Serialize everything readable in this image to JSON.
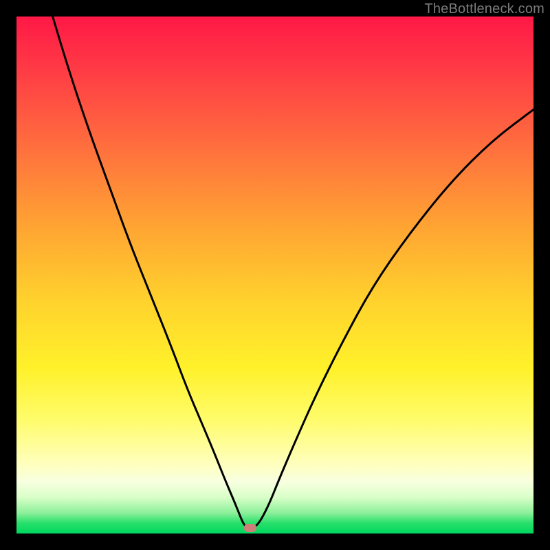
{
  "watermark": "TheBottleneck.com",
  "chart_data": {
    "type": "line",
    "title": "",
    "xlabel": "",
    "ylabel": "",
    "xlim": [
      0,
      100
    ],
    "ylim": [
      0,
      100
    ],
    "grid": false,
    "legend": false,
    "series": [
      {
        "name": "curve",
        "x": [
          7,
          10,
          14,
          18,
          22,
          26,
          30,
          33,
          36,
          38.5,
          40.5,
          42,
          43,
          43.7,
          44.3,
          45.3,
          46,
          46.6,
          47.5,
          49,
          51,
          54,
          58,
          63,
          69,
          76,
          84,
          92,
          100
        ],
        "y": [
          100,
          90,
          78,
          67,
          56,
          46,
          36,
          28,
          21,
          15,
          10,
          6.5,
          4,
          2.3,
          1.3,
          1.2,
          1.3,
          1.7,
          3,
          6,
          11,
          18,
          27,
          37,
          48,
          58,
          68,
          76,
          82
        ]
      }
    ],
    "marker": {
      "x": 45.2,
      "y": 1.0,
      "color": "#cc8077"
    },
    "gradient_stops": [
      {
        "pos": 0,
        "color": "#ff1846"
      },
      {
        "pos": 25,
        "color": "#ff6e3e"
      },
      {
        "pos": 55,
        "color": "#ffd22d"
      },
      {
        "pos": 90,
        "color": "#f8ffe0"
      },
      {
        "pos": 100,
        "color": "#00d65f"
      }
    ]
  }
}
